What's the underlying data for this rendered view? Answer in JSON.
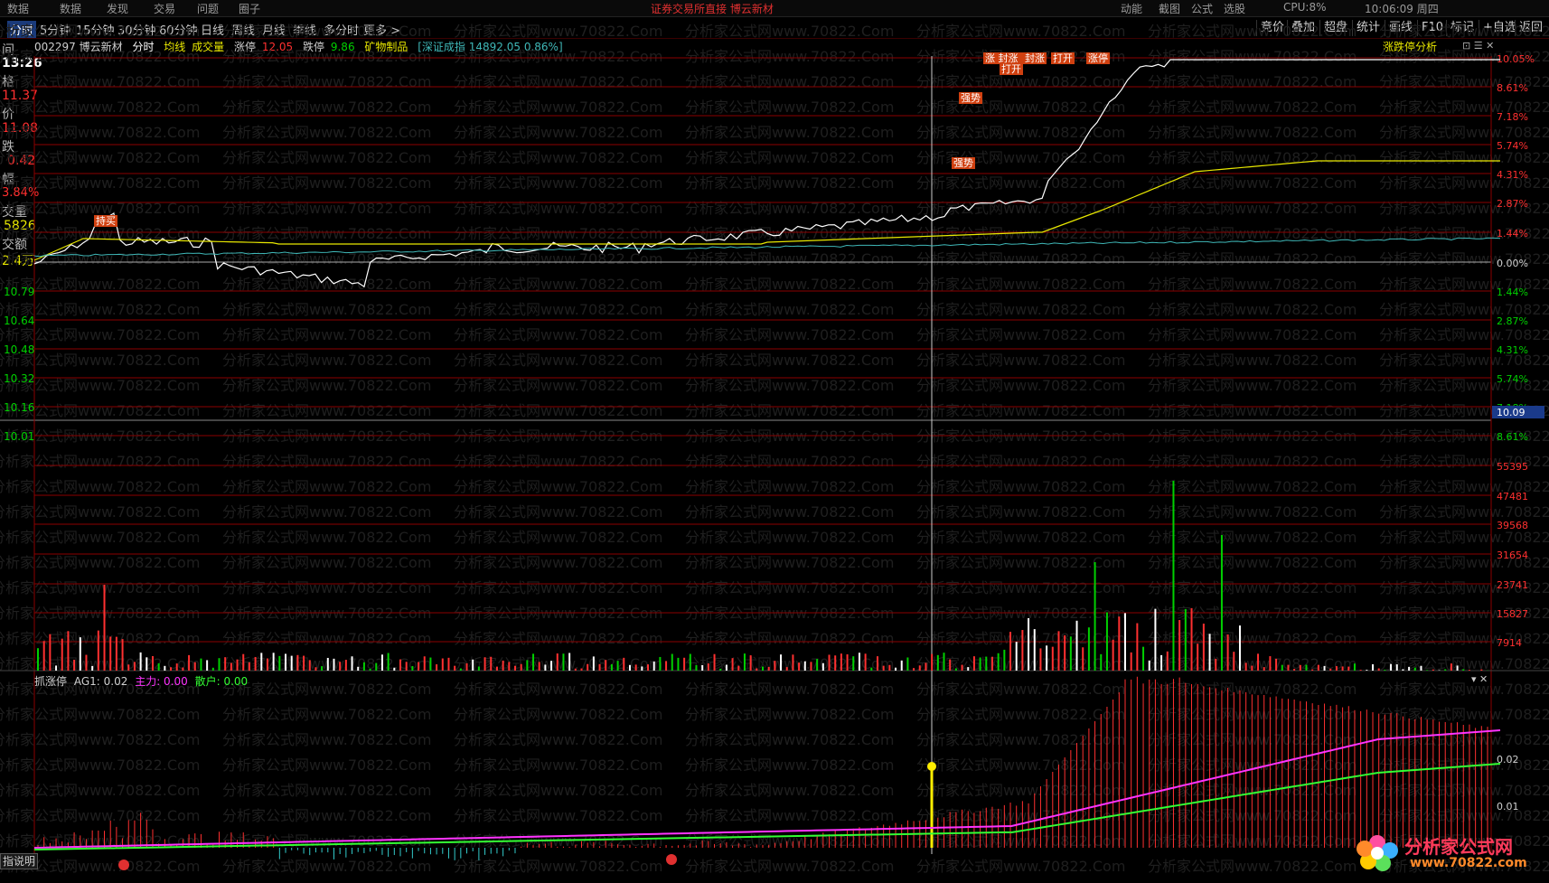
{
  "top_menu": [
    "数据",
    "数据",
    "发现",
    "交易",
    "问题",
    "圈子"
  ],
  "top_right": [
    "动能",
    "截图",
    "公式",
    "选股",
    "CPU:8%",
    "10:06:09 周四"
  ],
  "banner": "证券交易所直接 博云新材",
  "period_tabs": [
    "分时",
    "5分钟",
    "15分钟",
    "30分钟",
    "60分钟",
    "日线",
    "周线",
    "月线",
    "季线",
    "多分时",
    "更多 >"
  ],
  "toolbar_buttons": [
    "竞价",
    "叠加",
    "超盘",
    "统计",
    "画线",
    "F10",
    "标记",
    "+自选",
    "返回"
  ],
  "info": {
    "code": "002297 博云新材",
    "mode": "分时",
    "avg_label": "均线",
    "vol_label": "成交量",
    "limit_up_label": "涨停",
    "limit_up": "12.05",
    "limit_down_label": "跌停",
    "limit_down": "9.86",
    "sector": "矿物制品",
    "index": "[深证成指 14892.05 0.86%]",
    "right_label": "涨跌停分析"
  },
  "left_panel": {
    "l1": "间",
    "time": "13:26",
    "l2": "格",
    "price": "11.37",
    "l3": "价",
    "avg_price": "11.08",
    "l4": "跌",
    "change": "0.42",
    "l5": "幅",
    "change_pct": "3.84%",
    "l6": "交量",
    "volume": "5826",
    "l7": "交额",
    "amount": "2.4万"
  },
  "price_axis_left": [
    "10.79",
    "10.64",
    "10.48",
    "10.32",
    "10.16",
    "10.01"
  ],
  "pct_axis_right": [
    "10.05%",
    "8.61%",
    "7.18%",
    "5.74%",
    "4.31%",
    "2.87%",
    "1.44%",
    "0.00%",
    "1.44%",
    "2.87%",
    "4.31%",
    "5.74%",
    "7.18%",
    "8.61%"
  ],
  "current_price_tag": "10.09",
  "volume_axis": [
    "55395",
    "47481",
    "39568",
    "31654",
    "23741",
    "15827",
    "7914"
  ],
  "indicator": {
    "name": "抓涨停",
    "ag1": "AG1: 0.02",
    "main": "主力: 0.00",
    "retail": "散户: 0.00",
    "axis": [
      "0.02",
      "0.01"
    ]
  },
  "annotations": [
    "持买",
    "强势",
    "强势",
    "涨 封涨",
    "打开",
    "封涨",
    "打开",
    "涨停"
  ],
  "watermark": "分析家公式网www.70822.Com",
  "help_label": "指说明",
  "logo_text": "分析家公式网",
  "logo_url": "www.70822.com",
  "colors": {
    "grid": "#8b0000",
    "price": "#ffffff",
    "avg": "#e8e800",
    "index": "#3fb8b8",
    "up": "#ff3030",
    "down": "#00d000",
    "magenta": "#ff33ff",
    "green": "#33ff33"
  }
}
